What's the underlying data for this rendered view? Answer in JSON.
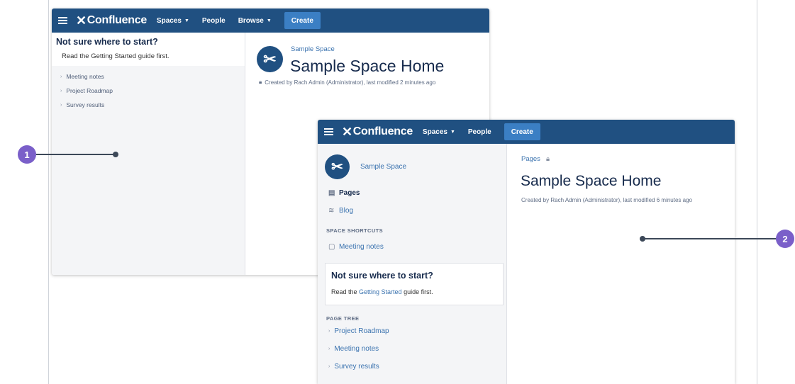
{
  "callouts": [
    {
      "label": "1"
    },
    {
      "label": "2"
    }
  ],
  "old_ui": {
    "nav": {
      "logo": "Confluence",
      "items": [
        "Spaces",
        "People",
        "Browse"
      ],
      "create": "Create"
    },
    "sidebar": {
      "tip_title": "Not sure where to start?",
      "tip_text": "Read the Getting Started guide first.",
      "tree": [
        "Meeting notes",
        "Project Roadmap",
        "Survey results"
      ]
    },
    "main": {
      "breadcrumb": "Sample Space",
      "title": "Sample Space Home",
      "meta": "Created by Rach Admin (Administrator), last modified 2 minutes ago"
    }
  },
  "new_ui": {
    "nav": {
      "logo": "Confluence",
      "items": [
        "Spaces",
        "People"
      ],
      "create": "Create"
    },
    "sidebar": {
      "space_name": "Sample Space",
      "pages": "Pages",
      "blog": "Blog",
      "shortcuts_heading": "SPACE SHORTCUTS",
      "shortcut": "Meeting notes",
      "tip_title": "Not sure where to start?",
      "tip_prefix": "Read the ",
      "tip_link": "Getting Started",
      "tip_suffix": " guide first.",
      "tree_heading": "PAGE TREE",
      "tree": [
        "Project Roadmap",
        "Meeting notes",
        "Survey results"
      ]
    },
    "main": {
      "breadcrumb": "Pages",
      "title": "Sample Space Home",
      "meta": "Created by Rach Admin (Administrator), last modified 6 minutes ago"
    }
  }
}
